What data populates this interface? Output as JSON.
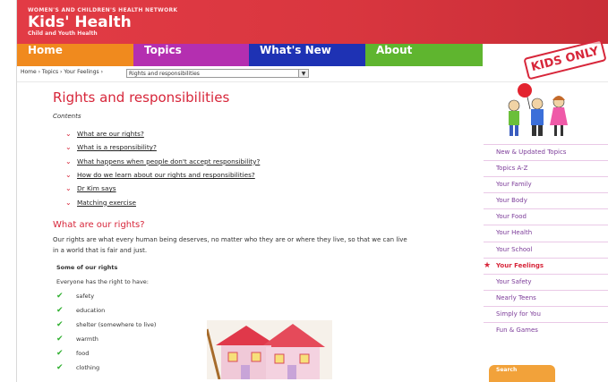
{
  "header": {
    "network": "WOMEN'S AND CHILDREN'S HEALTH NETWORK",
    "title": "Kids' Health",
    "tagline": "Child and Youth Health",
    "stamp": "KIDS ONLY"
  },
  "nav": {
    "home": "Home",
    "topics": "Topics",
    "whats_new": "What's New",
    "about": "About"
  },
  "breadcrumb": {
    "text": "Home › Topics › Your Feelings ›",
    "select_value": "Rights and responsibilities"
  },
  "main": {
    "title": "Rights and responsibilities",
    "contents_label": "Contents",
    "toc": [
      "What are our rights?",
      "What is a responsibility?",
      "What happens when people don't accept responsibility?",
      "How do we learn about our rights and responsibilities?",
      "Dr Kim says",
      "Matching exercise"
    ],
    "section_title": "What are our rights?",
    "paragraph": "Our rights are what every human being deserves, no matter who they are or where they live, so that we can live in a world that is fair and just.",
    "subheading": "Some of our rights",
    "right_to_have": "Everyone has the right to have:",
    "rights": [
      "safety",
      "education",
      "shelter (somewhere to live)",
      "warmth",
      "food",
      "clothing"
    ]
  },
  "sidebar": {
    "menu": [
      "New & Updated Topics",
      "Topics A-Z",
      "Your Family",
      "Your Body",
      "Your Food",
      "Your Health",
      "Your School",
      "Your Feelings",
      "Your Safety",
      "Nearly Teens",
      "Simply for You",
      "Fun & Games"
    ],
    "active_index": 7,
    "search_label": "Search"
  },
  "colors": {
    "header_red": "#e23b45",
    "nav_home": "#f08a1e",
    "nav_topics": "#b42fb0",
    "nav_new": "#1e32b4",
    "nav_about": "#5fb52f",
    "accent_red": "#d7263a",
    "menu_purple": "#7c3c99",
    "tick_green": "#30b030"
  }
}
